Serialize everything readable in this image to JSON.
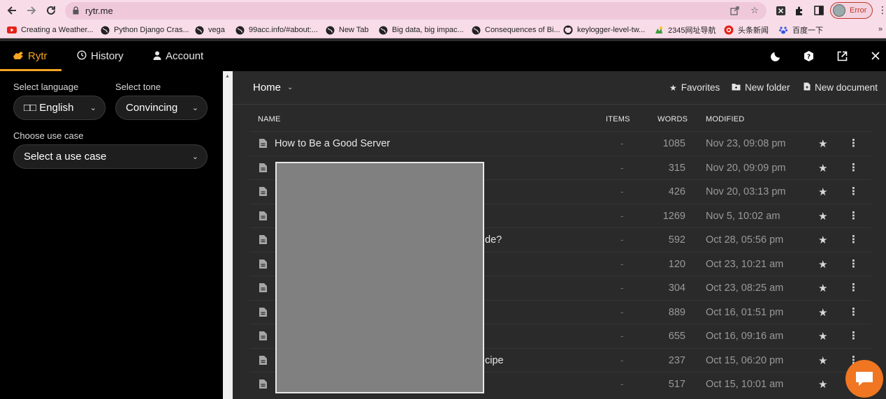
{
  "browser": {
    "url": "rytr.me",
    "profile_status": "Error",
    "bookmarks_more": "»",
    "bookmarks": [
      {
        "label": "Creating a Weather...",
        "icon": "youtube-icon",
        "color": "#e62117"
      },
      {
        "label": "Python Django Cras...",
        "icon": "globe-icon",
        "color": "#222222"
      },
      {
        "label": "vega",
        "icon": "globe-icon",
        "color": "#222222"
      },
      {
        "label": "99acc.info/#about:...",
        "icon": "globe-icon",
        "color": "#222222"
      },
      {
        "label": "New Tab",
        "icon": "globe-icon",
        "color": "#222222"
      },
      {
        "label": "Big data, big impac...",
        "icon": "globe-icon",
        "color": "#222222"
      },
      {
        "label": "Consequences of Bi...",
        "icon": "globe-icon",
        "color": "#222222"
      },
      {
        "label": "keylogger-level-tw...",
        "icon": "github-icon",
        "color": "#222222"
      },
      {
        "label": "2345网址导航",
        "icon": "2345-icon",
        "color": "#3a9a3a"
      },
      {
        "label": "头条新闻",
        "icon": "toutiao-icon",
        "color": "#e62117"
      },
      {
        "label": "百度一下",
        "icon": "baidu-icon",
        "color": "#2e54e8"
      }
    ]
  },
  "app": {
    "accent": "#f5a623",
    "tabs": [
      {
        "label": "Rytr",
        "icon": "hand-icon"
      },
      {
        "label": "History",
        "icon": "history-icon"
      },
      {
        "label": "Account",
        "icon": "user-icon"
      }
    ]
  },
  "sidebar": {
    "language_label": "Select language",
    "language_value": "□□ English",
    "tone_label": "Select tone",
    "tone_value": "Convincing",
    "usecase_label": "Choose use case",
    "usecase_value": "Select a use case"
  },
  "main": {
    "folder_title": "Home",
    "actions": {
      "favorites": "Favorites",
      "new_folder": "New folder",
      "new_document": "New document"
    },
    "columns": {
      "name": "NAME",
      "items": "ITEMS",
      "words": "WORDS",
      "modified": "MODIFIED"
    },
    "rows": [
      {
        "name": "How to Be a Good Server",
        "items": "-",
        "words": "1085",
        "modified": "Nov 23, 09:08 pm"
      },
      {
        "name": "",
        "items": "-",
        "words": "315",
        "modified": "Nov 20, 09:09 pm"
      },
      {
        "name": "",
        "items": "-",
        "words": "426",
        "modified": "Nov 20, 03:13 pm"
      },
      {
        "name": "",
        "items": "-",
        "words": "1269",
        "modified": "Nov 5, 10:02 am"
      },
      {
        "name": "de?",
        "items": "-",
        "words": "592",
        "modified": "Oct 28, 05:56 pm"
      },
      {
        "name": "",
        "items": "-",
        "words": "120",
        "modified": "Oct 23, 10:21 am"
      },
      {
        "name": "",
        "items": "-",
        "words": "304",
        "modified": "Oct 23, 08:25 am"
      },
      {
        "name": "",
        "items": "-",
        "words": "889",
        "modified": "Oct 16, 01:51 pm"
      },
      {
        "name": "",
        "items": "-",
        "words": "655",
        "modified": "Oct 16, 09:16 am"
      },
      {
        "name": "cipe",
        "items": "-",
        "words": "237",
        "modified": "Oct 15, 06:20 pm"
      },
      {
        "name": "",
        "items": "-",
        "words": "517",
        "modified": "Oct 15, 10:01 am"
      }
    ]
  }
}
